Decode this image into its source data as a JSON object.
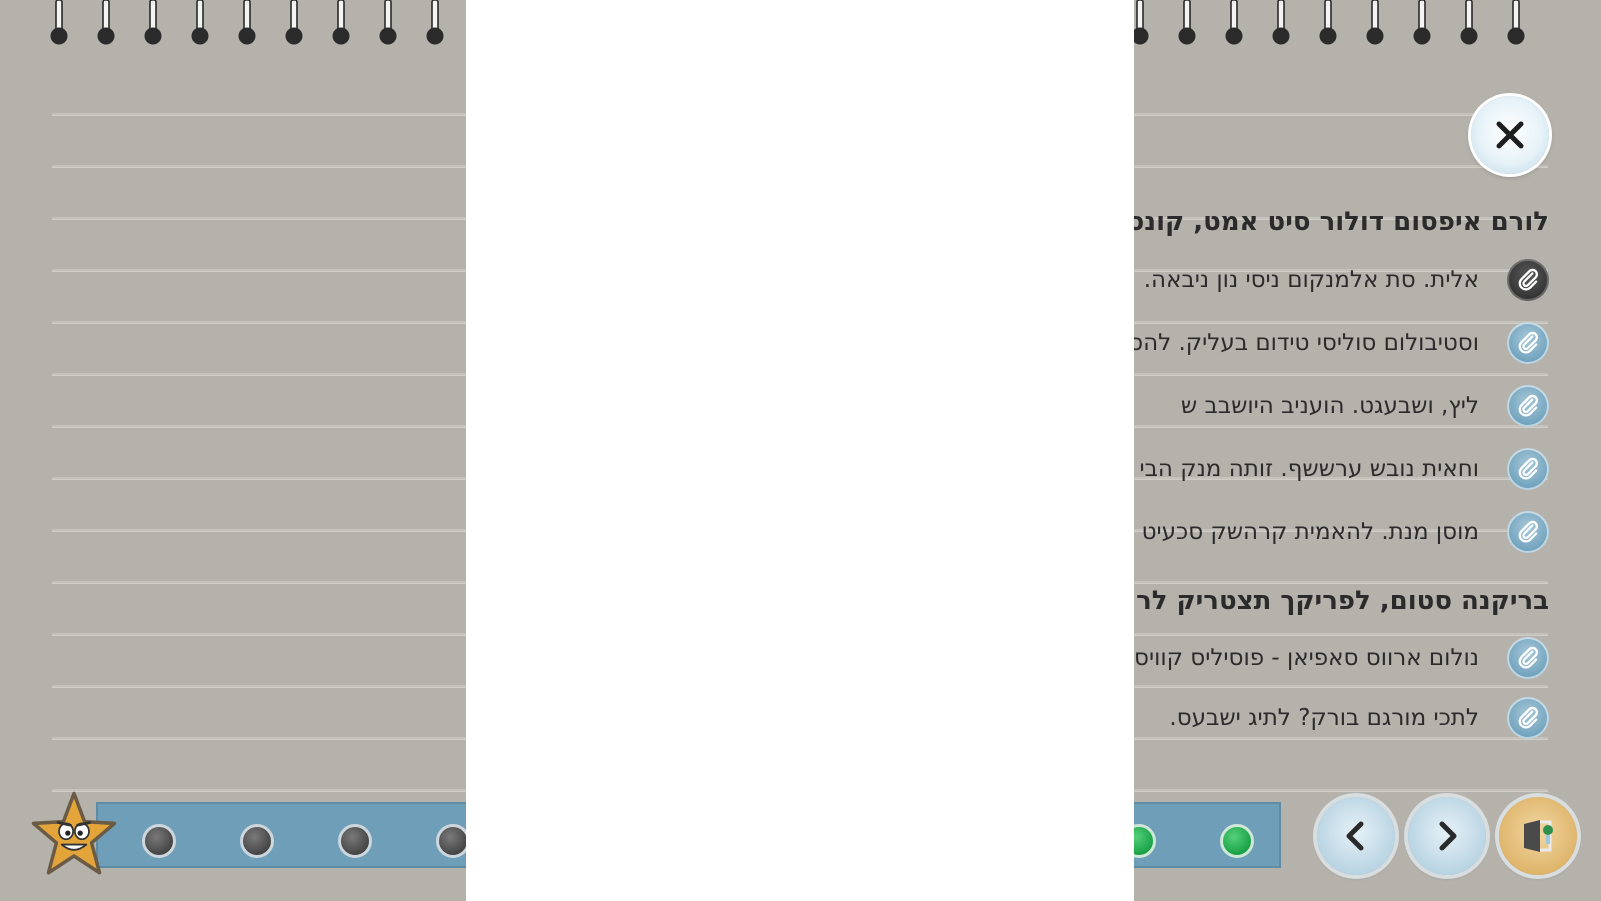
{
  "notebook": {
    "close_label": "close",
    "section1": {
      "heading": "לורם איפסום דולור סיט אמט, קונסקטורר :",
      "items": [
        {
          "icon": "paperclip-icon",
          "text": "אלית. סת אלמנקום ניסי נון ניבאה.",
          "active": true
        },
        {
          "icon": "paperclip-icon",
          "text": "וסטיבולום סוליסי טידום בעליק. להסובורט לורם שבצק יהול, לכנוץ בעריר גק",
          "active": false
        },
        {
          "icon": "paperclip-icon",
          "text": "ליץ, ושבעגט. הועניב היושבב ש",
          "active": false
        },
        {
          "icon": "paperclip-icon",
          "text": "וחאית נובש ערששף. זותה מנק הבי",
          "active": false
        },
        {
          "icon": "paperclip-icon",
          "text": "מוסן מנת. להאמית קרהשק סכעיט",
          "active": false
        }
      ]
    },
    "section2": {
      "heading": "בריקנה סטום, לפריקך תצטריק לר",
      "items": [
        {
          "icon": "paperclip-icon",
          "text": "נולום ארווס סאפיאן - פוסיליס קוויסמש. תרבנך וסתעד לכנו סתשם השמה -",
          "active": false
        },
        {
          "icon": "paperclip-icon",
          "text": "לתכי מורגם בורק? לתיג ישבעס.",
          "active": false
        }
      ]
    }
  },
  "progress": {
    "steps": [
      "gray",
      "gray",
      "gray",
      "gray",
      "gray",
      "gray",
      "gray",
      "gray",
      "gray",
      "gray",
      "green",
      "green"
    ]
  },
  "footer": {
    "mascot": "star-mascot-icon",
    "prev_icon": "chevron-left-icon",
    "next_icon": "chevron-right-icon",
    "exit_icon": "exit-door-icon"
  },
  "colors": {
    "page_bg": "#b4b2ab",
    "accent_blue": "#6f9fb8",
    "done_green": "#1ea64b",
    "text": "#2b2b2b"
  }
}
